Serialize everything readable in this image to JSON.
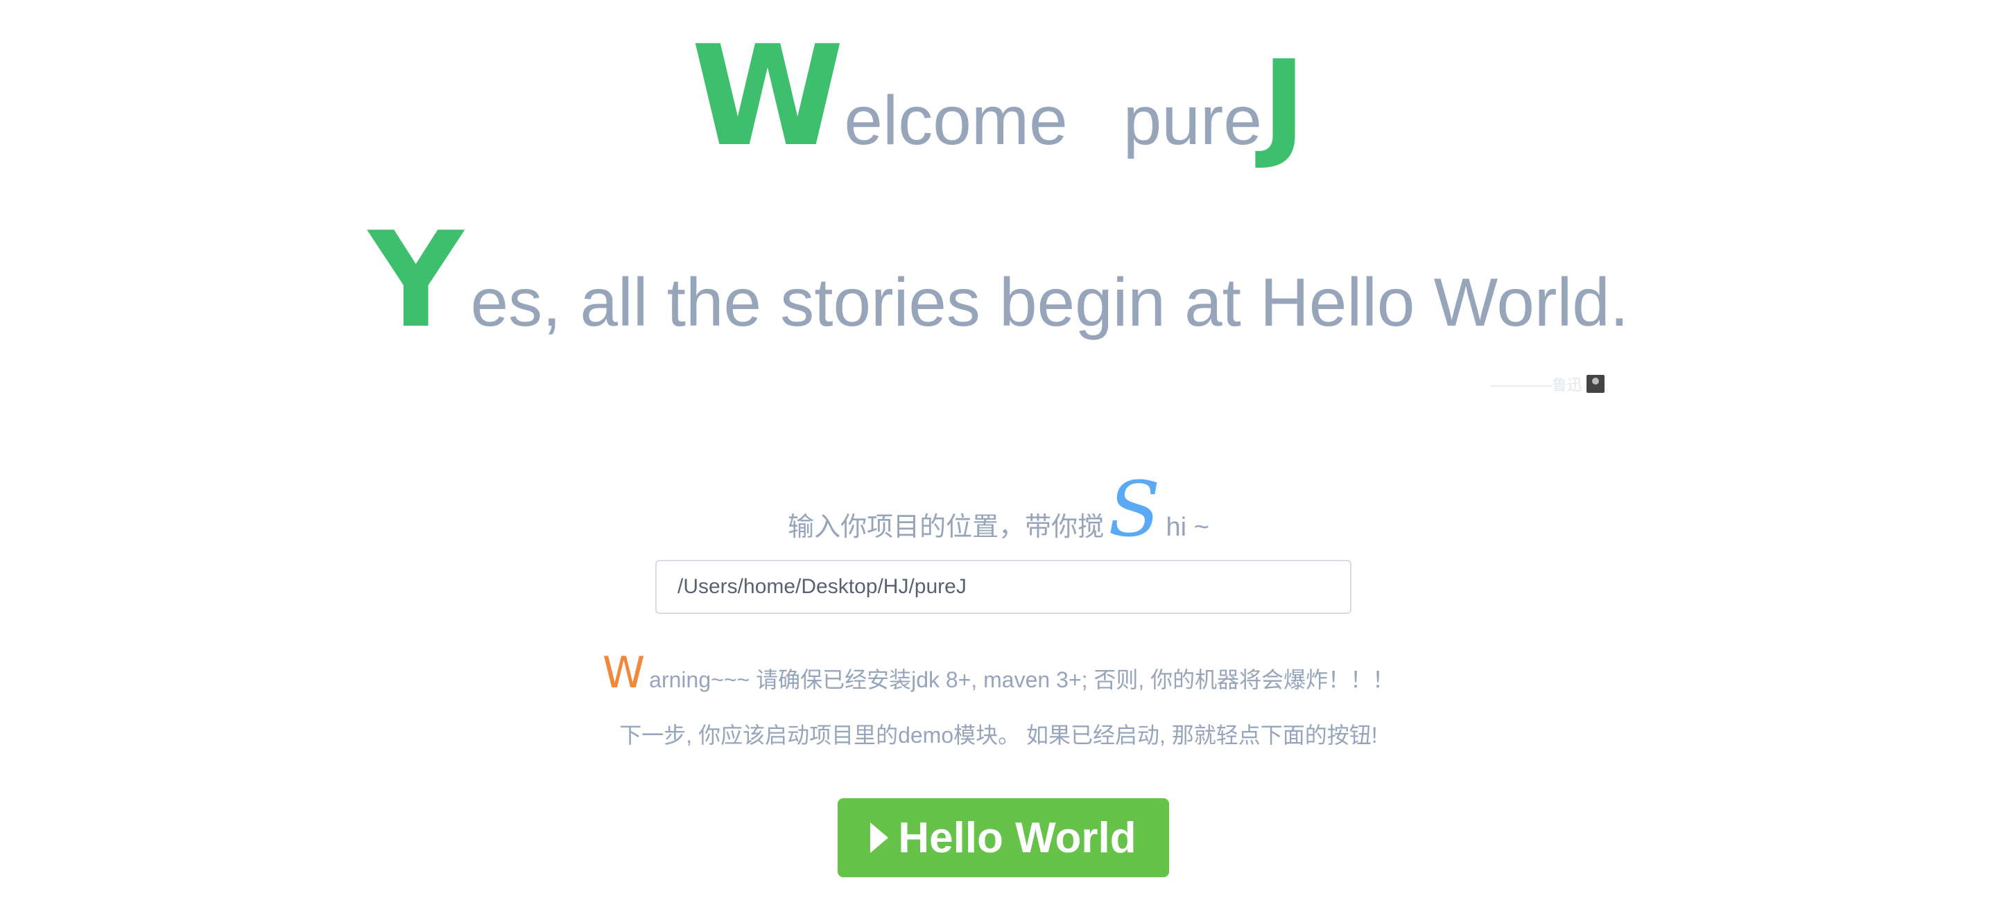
{
  "header": {
    "big_letter": "W",
    "text_1": "elcome",
    "text_2": "pure",
    "big_letter_end": "J"
  },
  "tagline": {
    "big_letter": "Y",
    "text": "es, all the stories begin at Hello World."
  },
  "attribution": {
    "text": "————鲁迅"
  },
  "prompt": {
    "text_before": "输入你项目的位置，带你搅",
    "big_letter": "S",
    "text_after": "hi ~"
  },
  "path_input": {
    "value": "/Users/home/Desktop/HJ/pureJ",
    "placeholder": ""
  },
  "warning": {
    "big_letter": "W",
    "text": "arning~~~ 请确保已经安装jdk 8+, maven 3+; 否则, 你的机器将会爆炸！！！"
  },
  "next_step": {
    "text": "下一步, 你应该启动项目里的demo模块。 如果已经启动, 那就轻点下面的按钮!"
  },
  "hello_button": {
    "label": "Hello World",
    "icon": "play-icon",
    "color": "#67c24a"
  },
  "colors": {
    "accent_green": "#3dbf6e",
    "accent_blue": "#5aa9f5",
    "accent_orange": "#f0883e",
    "text_gray": "#97a5bb"
  }
}
